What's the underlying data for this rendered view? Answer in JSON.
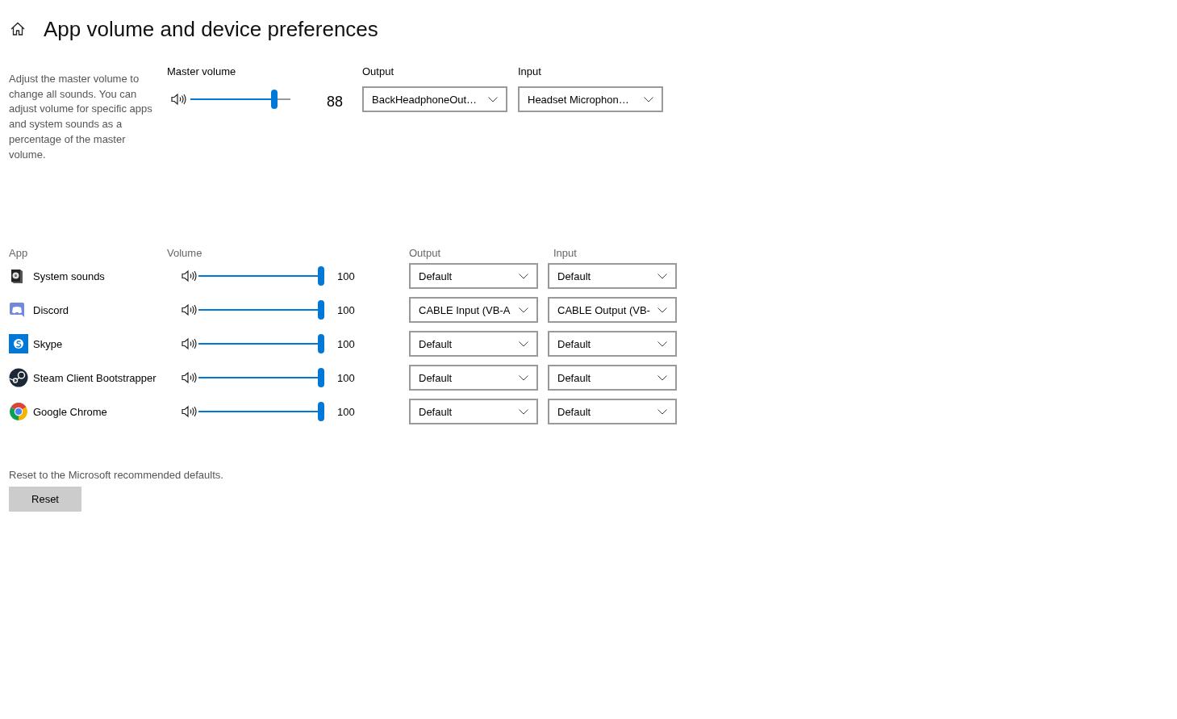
{
  "header": {
    "title": "App volume and device preferences"
  },
  "master": {
    "description": "Adjust the master volume to change all sounds. You can adjust volume for specific apps and system sounds as a percentage of the master volume.",
    "label": "Master volume",
    "level": 0.86,
    "reading": "88",
    "output": {
      "label": "Output",
      "value": "BackHeadphoneOut…"
    },
    "input": {
      "label": "Input",
      "value": "Headset Microphon…"
    }
  },
  "apps": {
    "columns": [
      "App",
      "Volume",
      "Output",
      "Input"
    ],
    "rows": [
      {
        "kind": "system",
        "name": "System sounds",
        "level": 1,
        "reading": "100",
        "output": "Default",
        "input": "Default"
      },
      {
        "kind": "discord",
        "name": "Discord",
        "level": 1,
        "reading": "100",
        "output": "CABLE Input (VB-A",
        "input": "CABLE Output (VB-"
      },
      {
        "kind": "skype",
        "name": "Skype",
        "level": 1,
        "reading": "100",
        "output": "Default",
        "input": "Default"
      },
      {
        "kind": "steam",
        "name": "Steam Client Bootstrapper",
        "level": 1,
        "reading": "100",
        "output": "Default",
        "input": "Default"
      },
      {
        "kind": "chrome",
        "name": "Google Chrome",
        "level": 1,
        "reading": "100",
        "output": "Default",
        "input": "Default"
      }
    ]
  },
  "reset": {
    "text": "Reset to the Microsoft recommended defaults.",
    "button": "Reset"
  }
}
